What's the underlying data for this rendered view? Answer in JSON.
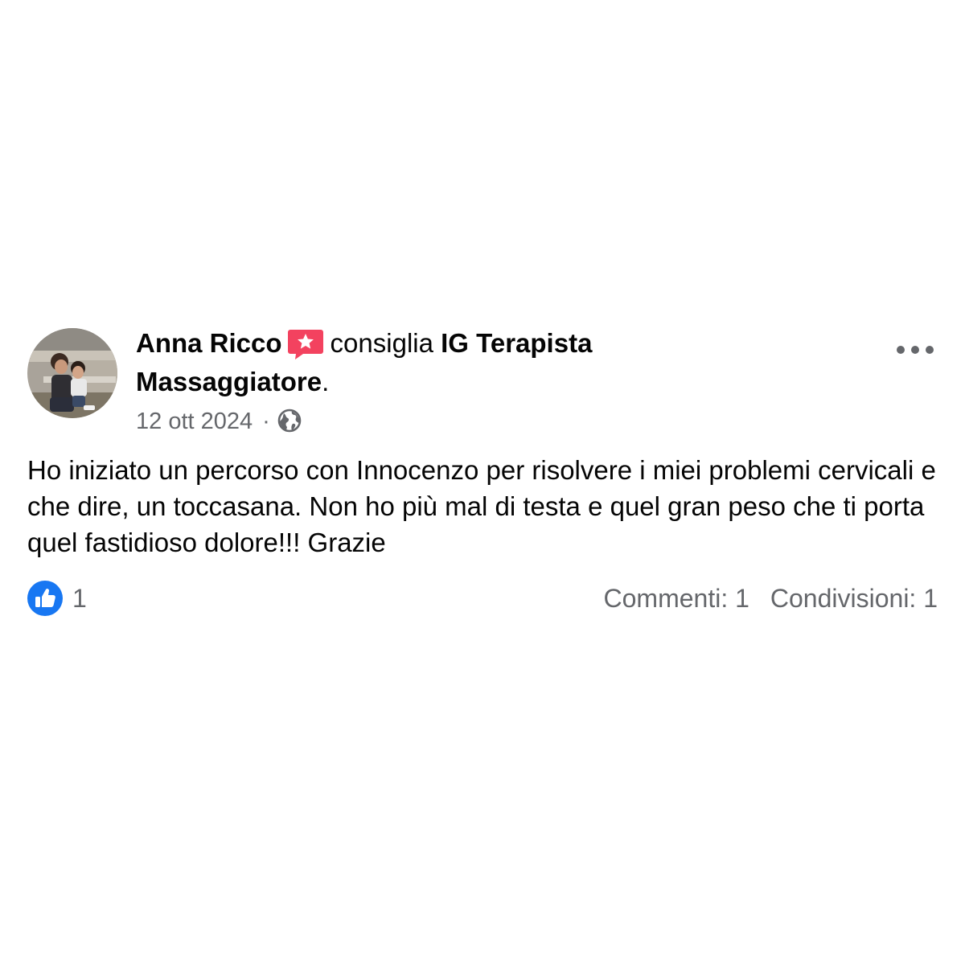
{
  "post": {
    "author": "Anna Ricco",
    "action": "consiglia",
    "page_name_line1": "IG Terapista",
    "page_name_line2": "Massaggiatore",
    "period": ".",
    "date": "12 ott 2024",
    "separator": "·",
    "privacy_icon": "globe-icon",
    "recommend_icon": "recommend-star-icon",
    "body": "Ho iniziato un percorso con Innocenzo per risolvere i miei problemi cervicali e che dire, un toccasana. Non ho più mal di testa e quel gran peso che ti porta quel fastidioso dolore!!! Grazie"
  },
  "engagement": {
    "like_count": "1",
    "comments": "Commenti: 1",
    "shares": "Condivisioni: 1"
  },
  "colors": {
    "recommend": "#f3425f",
    "like": "#1877f2",
    "secondary_text": "#65676b",
    "primary_text": "#050505"
  }
}
